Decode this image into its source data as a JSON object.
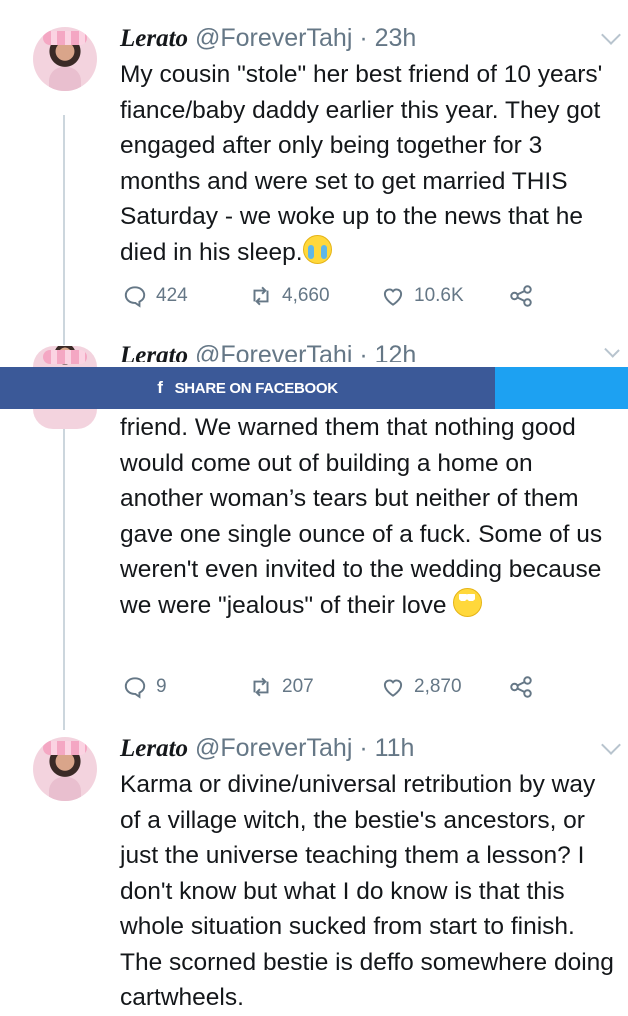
{
  "tweets": [
    {
      "name": "Lerato",
      "handle": "@ForeverTahj",
      "time": "· 23h",
      "text": "My cousin \"stole\" her best friend of 10 years' fiance/baby daddy earlier this year. They got engaged after only being together for 3 months and were set to get married THIS Saturday - we woke up to the news that he died in his sleep.",
      "emoji": "loudly-crying-face",
      "replies": "424",
      "retweets": "4,660",
      "likes": "10.6K"
    },
    {
      "name": "Lerato",
      "handle": "@ForeverTahj",
      "time": "· 12h",
      "text": "friend. We warned them that nothing good would come out of building a home on another woman’s tears but neither of them gave one single ounce of a fuck. Some of us weren't even invited to the wedding because we were \"jealous\" of their love",
      "emoji": "face-with-rolling-eyes",
      "replies": "9",
      "retweets": "207",
      "likes": "2,870"
    },
    {
      "name": "Lerato",
      "handle": "@ForeverTahj",
      "time": "· 11h",
      "text": "Karma or divine/universal retribution by way of a village witch, the bestie's ancestors, or just the universe teaching them a lesson? I don't know but what I do know is that this whole situation sucked from start to finish. The scorned bestie is deffo somewhere doing cartwheels."
    }
  ],
  "share_bar": {
    "facebook_icon": "f",
    "facebook_label": "SHARE ON FACEBOOK",
    "facebook_color": "#3b5998",
    "twitter_color": "#1da1f2"
  },
  "icons": [
    "reply-icon",
    "retweet-icon",
    "like-icon",
    "share-icon",
    "chevron-down-icon"
  ]
}
